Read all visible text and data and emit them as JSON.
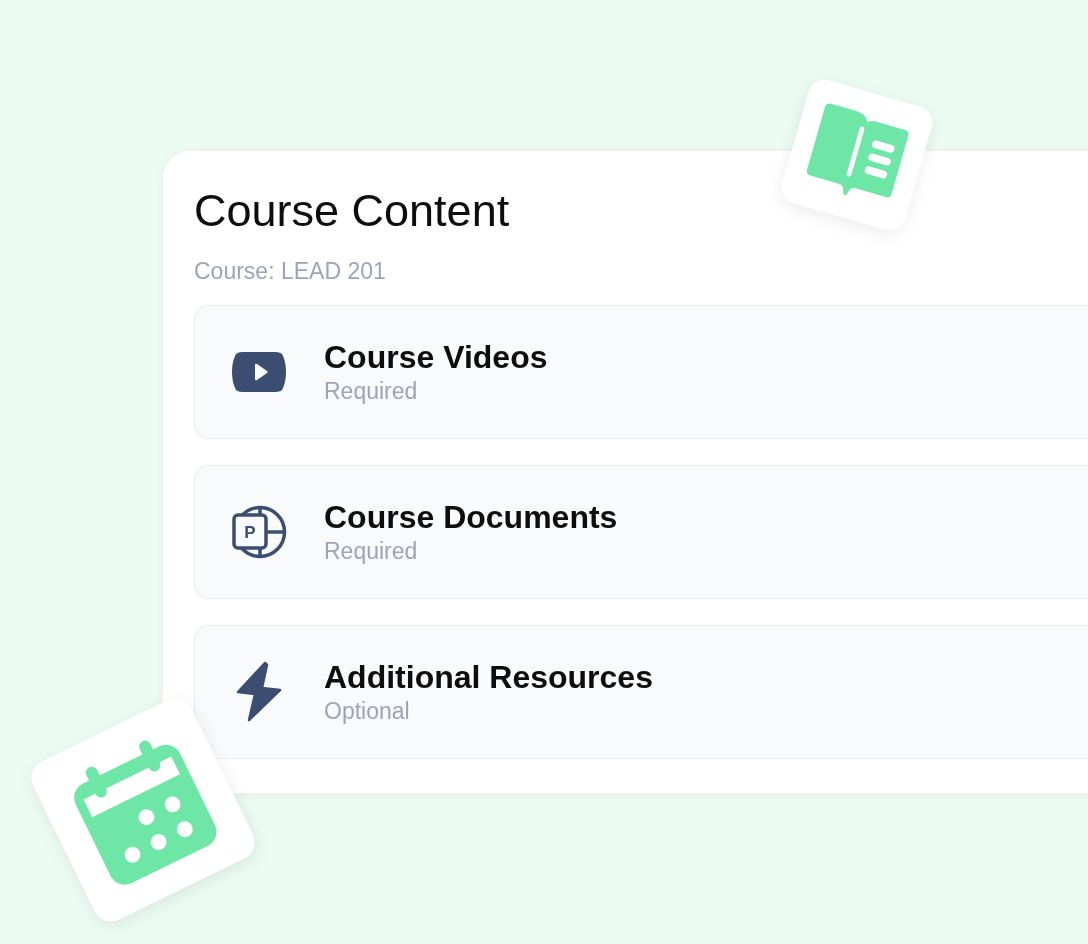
{
  "card": {
    "title": "Course Content",
    "subtitle": "Course: LEAD 201",
    "items": [
      {
        "kind": "video",
        "title": "Course Videos",
        "status": "Required"
      },
      {
        "kind": "presentation",
        "icon_text": "P",
        "title": "Course Documents",
        "status": "Required"
      },
      {
        "kind": "bolt",
        "title": "Additional Resources",
        "status": "Optional"
      }
    ]
  },
  "stickers": [
    {
      "kind": "book"
    },
    {
      "kind": "calendar"
    }
  ]
}
